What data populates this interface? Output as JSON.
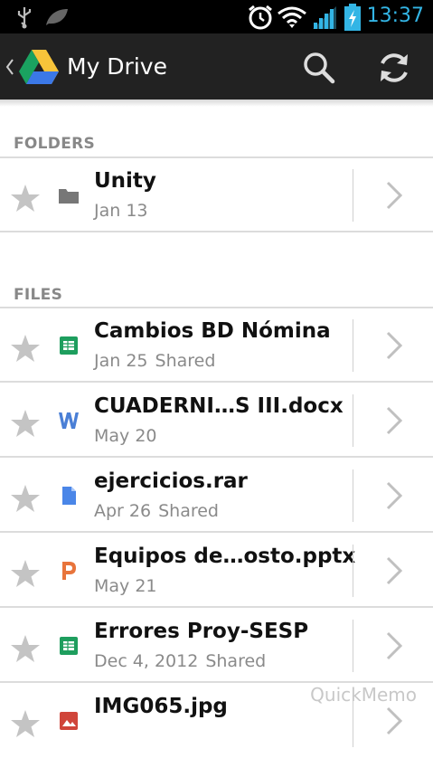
{
  "status": {
    "time": "13:37"
  },
  "actionbar": {
    "title": "My Drive"
  },
  "sections": {
    "folders": "FOLDERS",
    "files": "FILES"
  },
  "folders": [
    {
      "name": "Unity",
      "date": "Jan 13",
      "shared": "",
      "icon": "folder-icon"
    }
  ],
  "files": [
    {
      "name": "Cambios BD Nómina",
      "date": "Jan 25",
      "shared": "Shared",
      "icon": "spreadsheet-icon"
    },
    {
      "name": "CUADERNI…S III.docx",
      "date": "May 20",
      "shared": "",
      "icon": "word-doc-icon"
    },
    {
      "name": "ejercicios.rar",
      "date": "Apr 26",
      "shared": "Shared",
      "icon": "generic-file-icon"
    },
    {
      "name": "Equipos de…osto.pptx",
      "date": "May 21",
      "shared": "",
      "icon": "powerpoint-icon"
    },
    {
      "name": "Errores Proy-SESP",
      "date": "Dec 4, 2012",
      "shared": "Shared",
      "icon": "spreadsheet-icon"
    },
    {
      "name": "IMG065.jpg",
      "date": "",
      "shared": "",
      "icon": "image-icon"
    }
  ],
  "watermark": "QuickMemo",
  "colors": {
    "statusbar": "#000000",
    "actionbar": "#222222",
    "accent": "#33b5e5",
    "sheet": "#1e9e5e",
    "word": "#4a7fd6",
    "doc": "#4a86e8",
    "ppt": "#e8743b",
    "image": "#d0453a"
  }
}
